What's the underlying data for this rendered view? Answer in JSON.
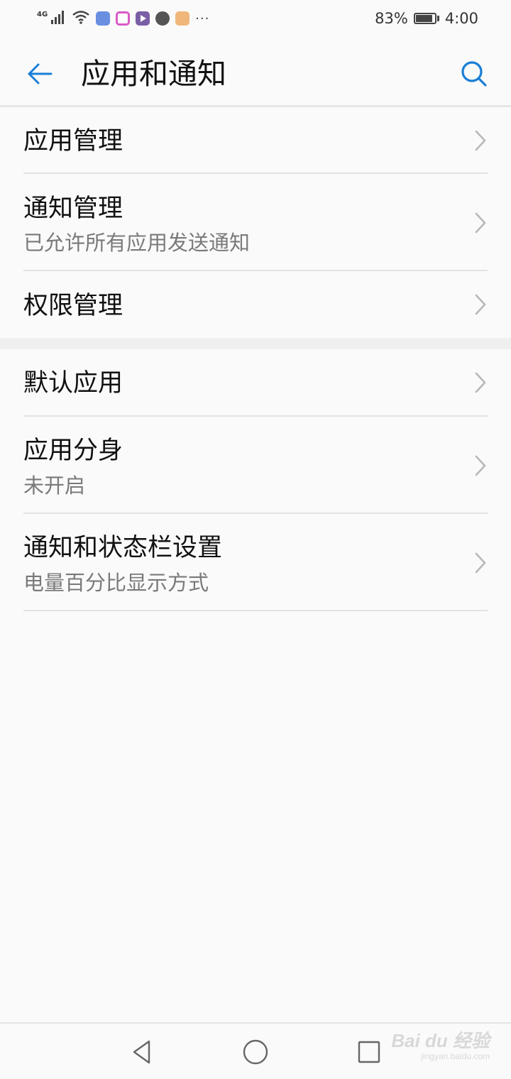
{
  "status_bar": {
    "network": "4G",
    "battery_percent": "83%",
    "battery_level": 0.83,
    "time": "4:00",
    "more": "···",
    "icons": [
      "signal-icon",
      "wifi-icon",
      "app-notification-icon-1",
      "app-notification-icon-2",
      "app-notification-icon-3",
      "app-notification-icon-4",
      "app-notification-icon-5"
    ]
  },
  "header": {
    "title": "应用和通知",
    "back_icon": "arrow-left-icon",
    "search_icon": "search-icon"
  },
  "sections": [
    {
      "items": [
        {
          "label": "应用管理",
          "sub": ""
        },
        {
          "label": "通知管理",
          "sub": "已允许所有应用发送通知"
        },
        {
          "label": "权限管理",
          "sub": ""
        }
      ]
    },
    {
      "items": [
        {
          "label": "默认应用",
          "sub": ""
        },
        {
          "label": "应用分身",
          "sub": "未开启"
        },
        {
          "label": "通知和状态栏设置",
          "sub": "电量百分比显示方式"
        }
      ]
    }
  ],
  "nav_bar": {
    "back": "triangle-back-icon",
    "home": "circle-home-icon",
    "recents": "square-recents-icon"
  },
  "watermark": {
    "main": "Bai du 经验",
    "sub": "jingyan.baidu.com"
  },
  "colors": {
    "accent": "#1a7fd6",
    "background": "#fafafa",
    "secondary_text": "#7a7a7a"
  }
}
